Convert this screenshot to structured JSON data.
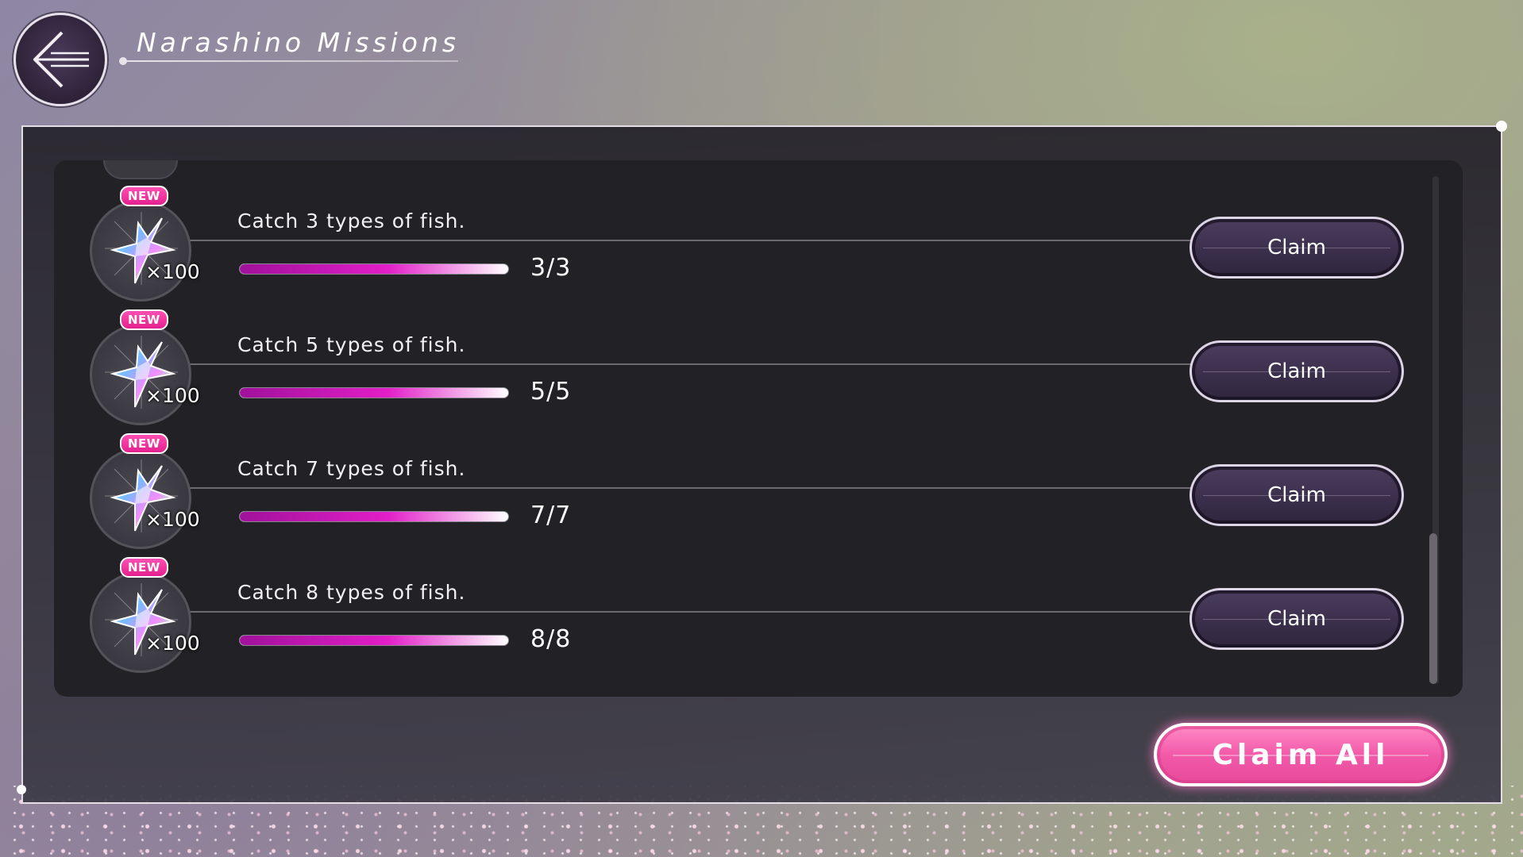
{
  "header": {
    "title": "Narashino Missions"
  },
  "missions": [
    {
      "badge": "NEW",
      "reward_qty": "×100",
      "description": "Catch 3 types of fish.",
      "progress_text": "3/3",
      "progress": 1.0,
      "button": "Claim"
    },
    {
      "badge": "NEW",
      "reward_qty": "×100",
      "description": "Catch 5 types of fish.",
      "progress_text": "5/5",
      "progress": 1.0,
      "button": "Claim"
    },
    {
      "badge": "NEW",
      "reward_qty": "×100",
      "description": "Catch 7 types of fish.",
      "progress_text": "7/7",
      "progress": 1.0,
      "button": "Claim"
    },
    {
      "badge": "NEW",
      "reward_qty": "×100",
      "description": "Catch 8 types of fish.",
      "progress_text": "8/8",
      "progress": 1.0,
      "button": "Claim"
    }
  ],
  "footer": {
    "claim_all": "Claim All"
  },
  "colors": {
    "accent_pink": "#f25aa9",
    "progress_magenta": "#e21ec8",
    "badge_pink": "#ff4fb3"
  }
}
